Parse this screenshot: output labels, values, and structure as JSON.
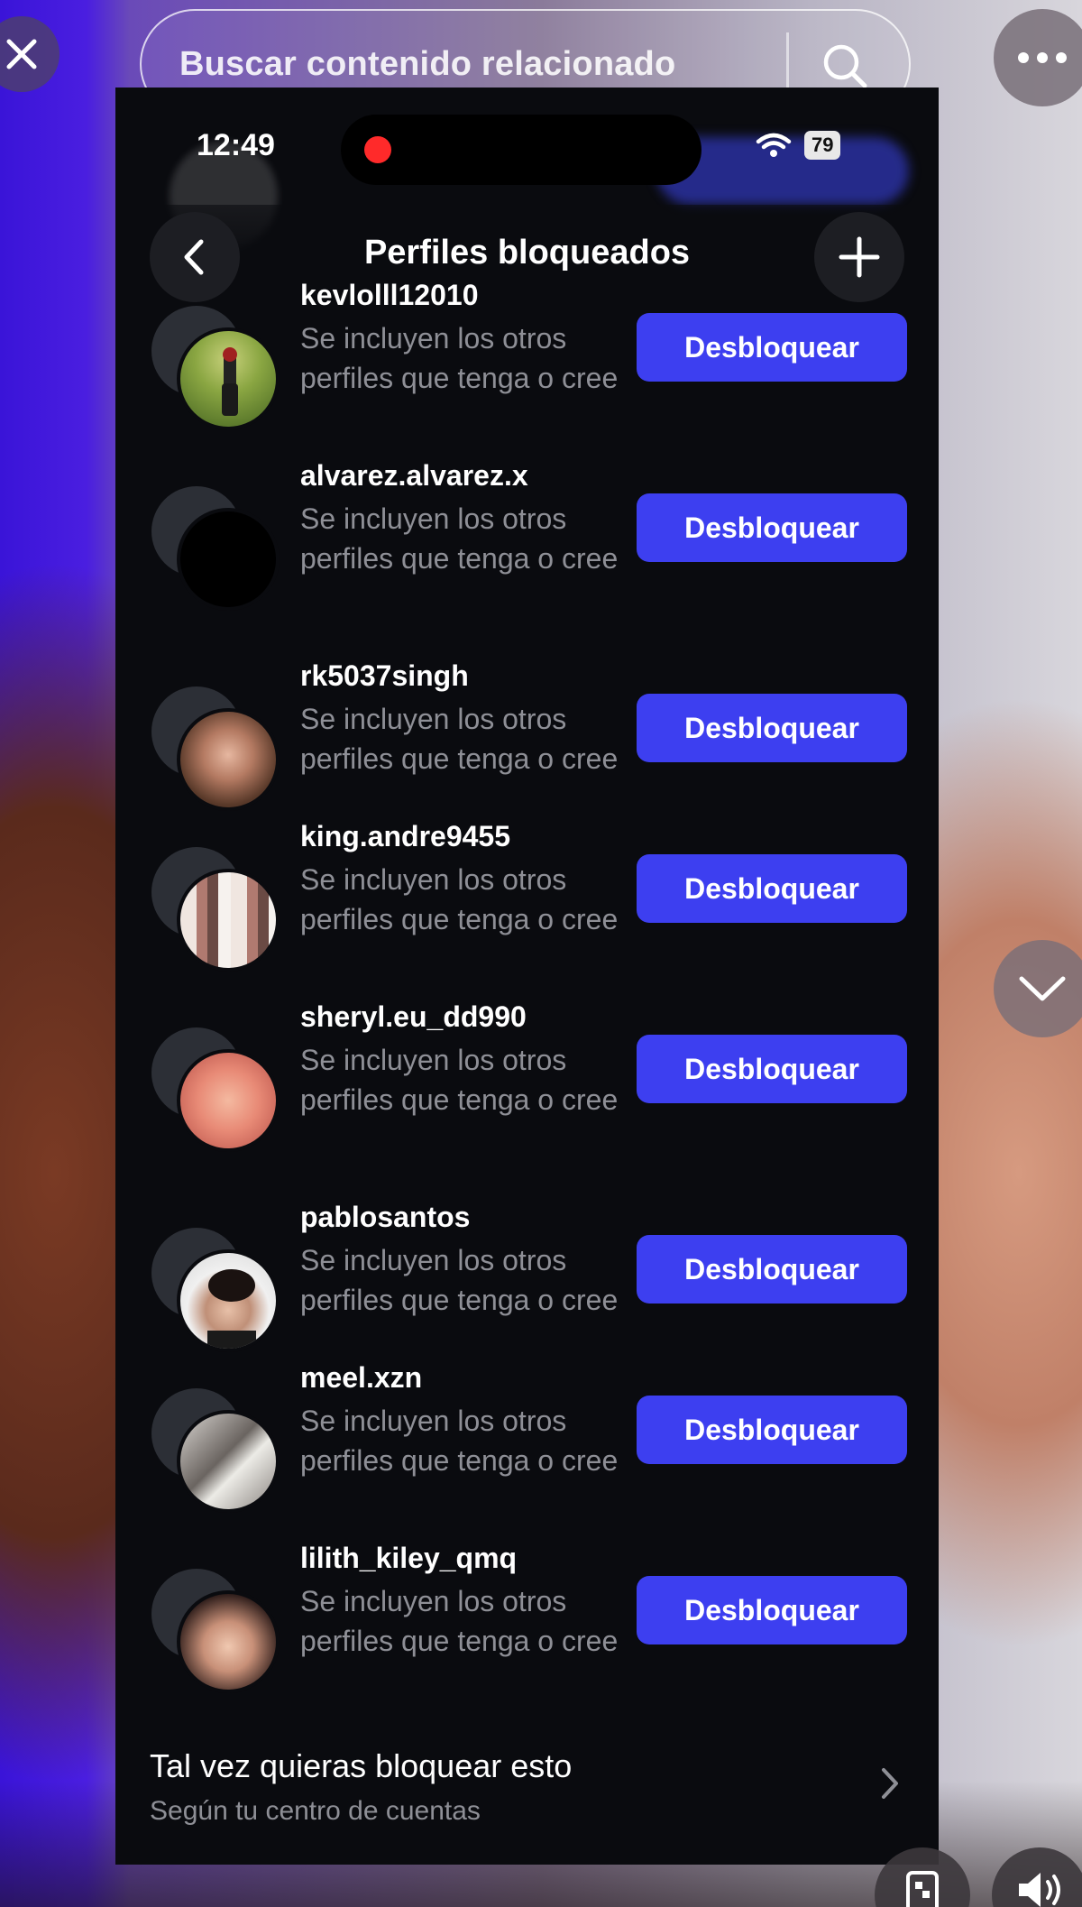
{
  "search": {
    "placeholder": "Buscar contenido relacionado"
  },
  "status_bar": {
    "time": "12:49",
    "battery": "79"
  },
  "header": {
    "title": "Perfiles bloqueados"
  },
  "blocked_profiles": [
    {
      "username": "kevlolll12010",
      "description": "Se incluyen los otros perfiles que tenga o cree",
      "button": "Desbloquear"
    },
    {
      "username": "alvarez.alvarez.x",
      "description": "Se incluyen los otros perfiles que tenga o cree",
      "button": "Desbloquear"
    },
    {
      "username": "rk5037singh",
      "description": "Se incluyen los otros perfiles que tenga o cree",
      "button": "Desbloquear"
    },
    {
      "username": "king.andre9455",
      "description": "Se incluyen los otros perfiles que tenga o cree",
      "button": "Desbloquear"
    },
    {
      "username": "sheryl.eu_dd990",
      "description": "Se incluyen los otros perfiles que tenga o cree",
      "button": "Desbloquear"
    },
    {
      "username": "pablosantos",
      "description": "Se incluyen los otros perfiles que tenga o cree",
      "button": "Desbloquear"
    },
    {
      "username": "meel.xzn",
      "description": "Se incluyen los otros perfiles que tenga o cree",
      "button": "Desbloquear"
    },
    {
      "username": "lilith_kiley_qmq",
      "description": "Se incluyen los otros perfiles que tenga o cree",
      "button": "Desbloquear"
    }
  ],
  "suggestion": {
    "title": "Tal vez quieras bloquear esto",
    "subtitle": "Según tu centro de cuentas"
  },
  "icons": {
    "close": "close-icon",
    "more": "more-icon",
    "search": "search-icon",
    "back": "chevron-left-icon",
    "add": "plus-icon",
    "scroll_down": "chevron-down-icon",
    "suggestion_arrow": "chevron-right-icon",
    "wifi": "wifi-icon",
    "screen_cast": "screen-cast-icon",
    "volume": "volume-icon"
  },
  "colors": {
    "accent": "#3d3ff0",
    "background": "#0a0b0f",
    "secondary_text": "#8e8f96"
  }
}
